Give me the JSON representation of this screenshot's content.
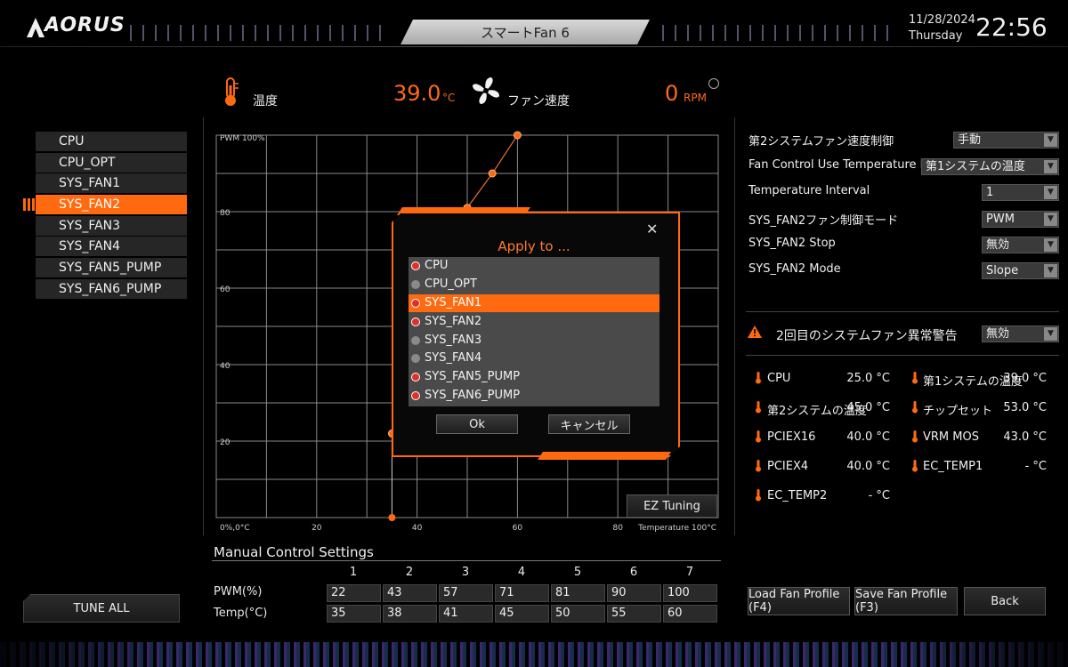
{
  "header": {
    "brand": "AORUS",
    "title": "スマートFan 6",
    "date": "11/28/2024",
    "weekday": "Thursday",
    "time": "22:56"
  },
  "readouts": {
    "temp_label": "温度",
    "temp_value": "39.0",
    "temp_unit": "°C",
    "fan_label": "ファン速度",
    "rpm_value": "0",
    "rpm_unit": "RPM"
  },
  "fan_list": [
    "CPU",
    "CPU_OPT",
    "SYS_FAN1",
    "SYS_FAN2",
    "SYS_FAN3",
    "SYS_FAN4",
    "SYS_FAN5_PUMP",
    "SYS_FAN6_PUMP"
  ],
  "fan_list_active_index": 3,
  "tune_all_label": "TUNE ALL",
  "chart": {
    "y_top_label": "PWM 100%",
    "y_ticks": [
      "80",
      "60",
      "40",
      "20"
    ],
    "origin_label": "0%,0°C",
    "x_ticks": [
      "20",
      "40",
      "60",
      "80"
    ],
    "x_end_label": "Temperature 100°C",
    "ez_tuning_label": "EZ Tuning",
    "accent_color": "#ff6a10"
  },
  "manual": {
    "title": "Manual Control Settings",
    "columns": [
      "1",
      "2",
      "3",
      "4",
      "5",
      "6",
      "7"
    ],
    "pwm_label": "PWM(%)",
    "temp_label": "Temp(°C)",
    "pwm": [
      "22",
      "43",
      "57",
      "71",
      "81",
      "90",
      "100"
    ],
    "temp": [
      "35",
      "38",
      "41",
      "45",
      "50",
      "55",
      "60"
    ]
  },
  "right_panel": {
    "settings": [
      {
        "label": "第2システムファン速度制御",
        "value": "手動"
      },
      {
        "label": "Fan Control Use Temperature Input",
        "value": "第1システムの温度"
      },
      {
        "label": "Temperature Interval",
        "value": "1"
      },
      {
        "label": "SYS_FAN2ファン制御モード",
        "value": "PWM"
      },
      {
        "label": "SYS_FAN2 Stop",
        "value": "無効"
      },
      {
        "label": "SYS_FAN2 Mode",
        "value": "Slope"
      }
    ],
    "warning_label": "2回目のシステムファン異常警告",
    "warning_value": "無効",
    "sensors_left": [
      {
        "name": "CPU",
        "value": "25.0 °C"
      },
      {
        "name": "第2システムの温度",
        "value": "45.0 °C"
      },
      {
        "name": "PCIEX16",
        "value": "40.0 °C"
      },
      {
        "name": "PCIEX4",
        "value": "40.0 °C"
      },
      {
        "name": "EC_TEMP2",
        "value": "- °C"
      }
    ],
    "sensors_right": [
      {
        "name": "第1システムの温度",
        "value": "39.0 °C"
      },
      {
        "name": "チップセット",
        "value": "53.0 °C"
      },
      {
        "name": "VRM MOS",
        "value": "43.0 °C"
      },
      {
        "name": "EC_TEMP1",
        "value": "- °C"
      }
    ],
    "buttons": [
      "Load Fan Profile (F4)",
      "Save Fan Profile (F3)",
      "Back"
    ]
  },
  "dialog": {
    "title": "Apply to ...",
    "items": [
      {
        "label": "CPU",
        "checked": true
      },
      {
        "label": "CPU_OPT",
        "checked": false
      },
      {
        "label": "SYS_FAN1",
        "checked": true
      },
      {
        "label": "SYS_FAN2",
        "checked": true
      },
      {
        "label": "SYS_FAN3",
        "checked": false
      },
      {
        "label": "SYS_FAN4",
        "checked": false
      },
      {
        "label": "SYS_FAN5_PUMP",
        "checked": true
      },
      {
        "label": "SYS_FAN6_PUMP",
        "checked": true
      }
    ],
    "selected_index": 2,
    "ok_label": "Ok",
    "cancel_label": "キャンセル",
    "close_glyph": "✕"
  }
}
